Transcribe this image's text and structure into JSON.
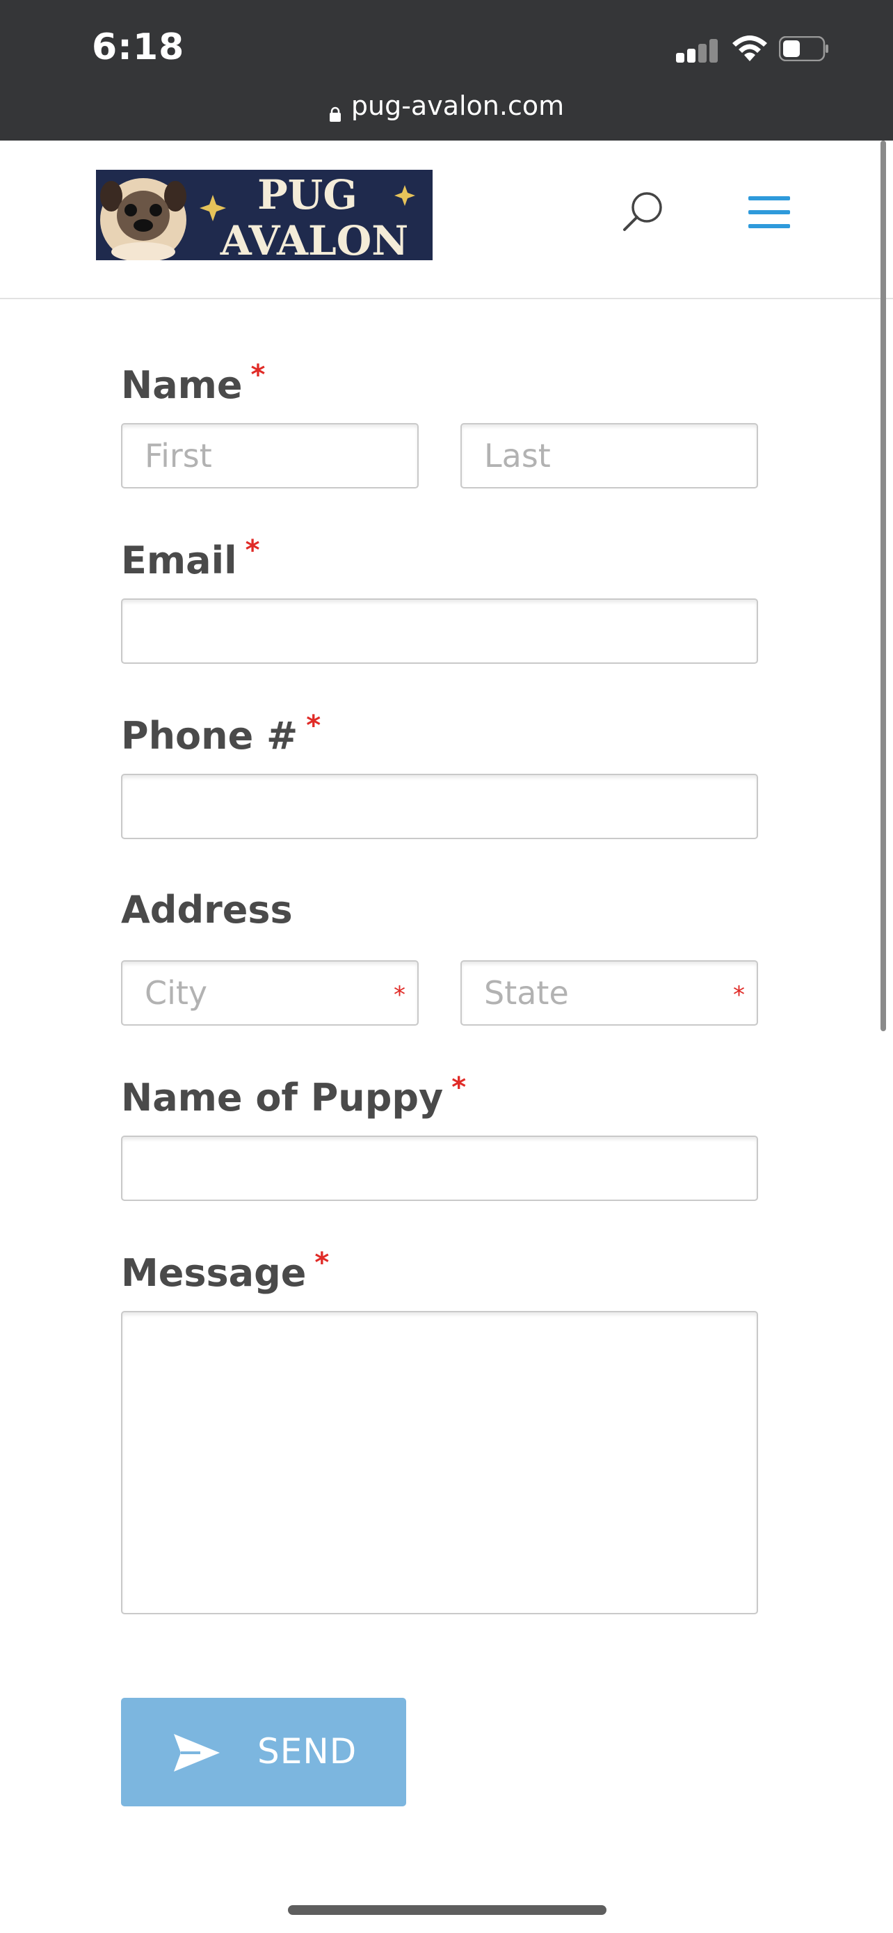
{
  "status_bar": {
    "time": "6:18"
  },
  "browser": {
    "url": "pug-avalon.com"
  },
  "header": {
    "logo_text_line1": "PUG",
    "logo_text_line2": "AVALON",
    "search_icon": "search-icon",
    "menu_icon": "hamburger-menu-icon",
    "accent_color": "#2e9adb"
  },
  "form": {
    "required_marker": "*",
    "name": {
      "label": "Name",
      "first_placeholder": "First",
      "last_placeholder": "Last"
    },
    "email": {
      "label": "Email"
    },
    "phone": {
      "label": "Phone #"
    },
    "address": {
      "label": "Address",
      "city_placeholder": "City",
      "state_placeholder": "State"
    },
    "puppy": {
      "label": "Name of Puppy"
    },
    "message": {
      "label": "Message"
    },
    "send_label": "SEND",
    "send_color": "#7cb6df",
    "required_color": "#e02b27"
  }
}
